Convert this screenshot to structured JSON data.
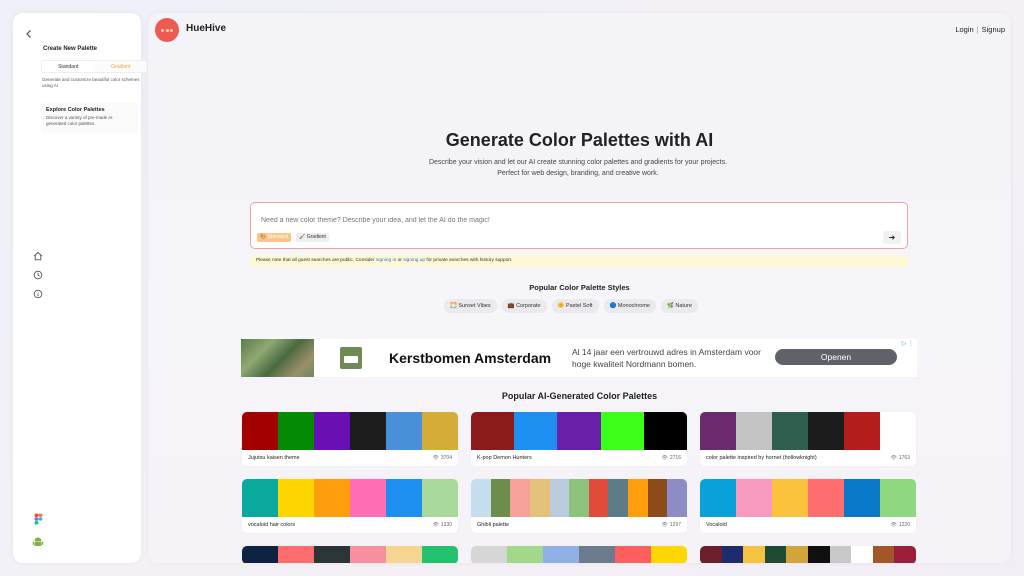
{
  "sidebar": {
    "create_title": "Create New Palette",
    "tabs": [
      "Standard",
      "Gradient"
    ],
    "create_desc": "Generate and customize beautiful color schemes using AI",
    "explore_title": "Explore Color Palettes",
    "explore_desc": "Discover a variety of pre-made AI generated color palettes."
  },
  "header": {
    "brand": "HueHive",
    "login": "Login",
    "separator": "|",
    "signup": "Signup"
  },
  "hero": {
    "title": "Generate Color Palettes with AI",
    "subtitle": "Describe your vision and let our AI create stunning color palettes and gradients for your projects. Perfect for web design, branding, and creative work."
  },
  "prompt": {
    "placeholder": "Need a new color theme? Describe your idea, and let the AI do the magic!",
    "chip_standard": "🎨 Standard",
    "chip_gradient": "🖌 Gradient",
    "send_label": "➜"
  },
  "notice": {
    "text_before": "Please note that all guest searches are public. Consider ",
    "link_signin": "signing in",
    "text_mid": " or ",
    "link_signup": "signing up",
    "text_after": " for private searches with history support."
  },
  "styles": {
    "title": "Popular Color Palette Styles",
    "items": [
      "🌅 Sunset Vibes",
      "💼 Corporate",
      "🌼 Pastel Soft",
      "🔵 Monochrome",
      "🌿 Nature"
    ]
  },
  "ad": {
    "title": "Kerstbomen Amsterdam",
    "text": "Al 14 jaar een vertrouwd adres in Amsterdam voor hoge kwaliteit Nordmann bomen.",
    "button": "Openen",
    "choice": "▷ ⋮"
  },
  "popular": {
    "title": "Popular AI-Generated Color Palettes",
    "cards": [
      {
        "name": "Jujutsu kaisen theme",
        "views": "3704",
        "colors": [
          "#a30000",
          "#058a05",
          "#6a0fb3",
          "#1d1d1d",
          "#4a90d9",
          "#d4ac37"
        ]
      },
      {
        "name": "K-pop Demon Hunters",
        "views": "2716",
        "colors": [
          "#8b1a1a",
          "#1f8ef1",
          "#6a1fa8",
          "#3cff1a",
          "#000000"
        ]
      },
      {
        "name": "color palette inspired by hornet (hollowknight)",
        "views": "1763",
        "colors": [
          "#6b2a6e",
          "#c4c4c4",
          "#2f5e4f",
          "#1c1c1c",
          "#b51c1c",
          "#ffffff"
        ]
      },
      {
        "name": "vocaloid hair colors",
        "views": "1330",
        "colors": [
          "#0aa99e",
          "#ffd600",
          "#ff9e0c",
          "#ff6eb4",
          "#1f8ef1",
          "#a8d89a"
        ]
      },
      {
        "name": "Ghibli palette",
        "views": "1297",
        "colors": [
          "#c6dcef",
          "#6d8d4b",
          "#f6a09a",
          "#e5c07b",
          "#b9cbdc",
          "#8dc27d",
          "#e24b3c",
          "#5d7b86",
          "#ff9e0c",
          "#8b4b1b",
          "#8e8cc5"
        ]
      },
      {
        "name": "Vocaloid",
        "views": "1220",
        "colors": [
          "#0aa0d8",
          "#f79ac0",
          "#f9c23c",
          "#ff6e6e",
          "#0a78c8",
          "#8fd880"
        ]
      },
      {
        "name": "",
        "views": "",
        "colors": [
          "#0e2244",
          "#fd6d6d",
          "#2b3437",
          "#f98ea0",
          "#f5d58f",
          "#23c26e"
        ]
      },
      {
        "name": "",
        "views": "",
        "colors": [
          "#d6d6d6",
          "#a3d88a",
          "#8fb1e6",
          "#6d7c8c",
          "#fd5e5e",
          "#ffd600"
        ]
      },
      {
        "name": "",
        "views": "",
        "colors": [
          "#6b1f2a",
          "#1e2b6e",
          "#f5c242",
          "#1f4a34",
          "#d4a43c",
          "#0f0f0f",
          "#c8c8c8",
          "#ffffff",
          "#a3562a",
          "#9c1f3a"
        ]
      }
    ]
  }
}
